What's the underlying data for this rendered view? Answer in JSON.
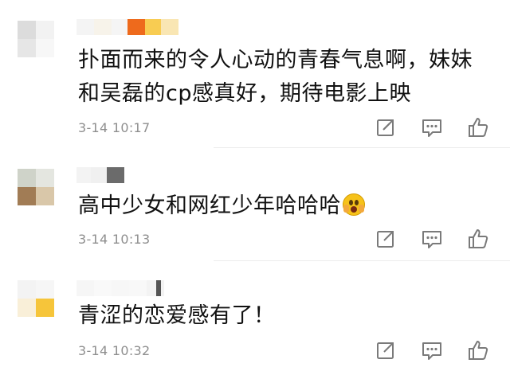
{
  "comments": [
    {
      "text": "扑面而来的令人心动的青春气息啊，妹妹\n和吴磊的cp感真好，期待电影上映",
      "time": "3-14 10:17",
      "emoji": ""
    },
    {
      "text": "高中少女和网红少年哈哈哈",
      "time": "3-14 10:13",
      "emoji": "screaming-face-emoji"
    },
    {
      "text": "青涩的恋爱感有了！",
      "time": "3-14 10:32",
      "emoji": ""
    }
  ],
  "icons": {
    "share": "share-icon",
    "reply": "comment-icon",
    "like": "thumbs-up-icon"
  },
  "colors": {
    "text": "#111111",
    "meta": "#8e8e8e",
    "icon": "#7a7a7a",
    "divider": "#ececec"
  }
}
